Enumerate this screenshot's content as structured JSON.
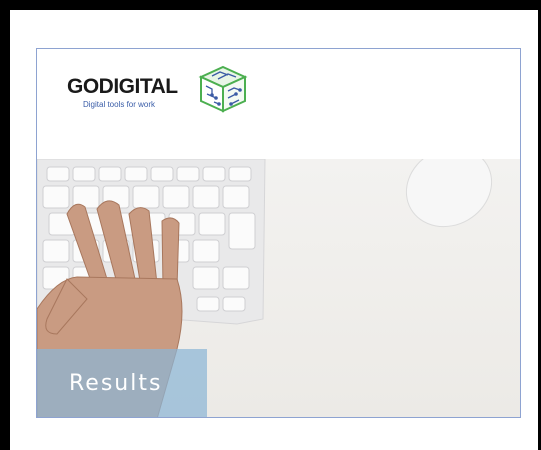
{
  "logo": {
    "name": "GODIGITAL",
    "tagline": "Digital tools for work"
  },
  "hero": {
    "caption": "Results"
  },
  "colors": {
    "frame": "#000000",
    "card_border": "#8ea3d1",
    "tagline": "#3a5da8",
    "icon_green": "#4caf50",
    "icon_blue": "#3b5ba5",
    "caption_overlay": "#8cb6d6"
  },
  "icons": [
    "circuit-box-logo-icon"
  ]
}
